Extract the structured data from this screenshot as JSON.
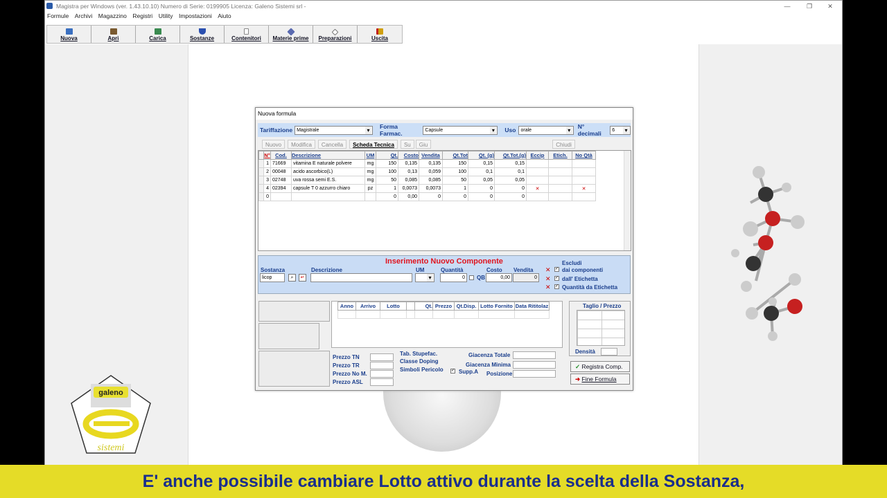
{
  "window": {
    "title": "Magistra per Windows  (ver. 1.43.10.10)  Numero di Serie: 0199905   Licenza: Galeno Sistemi srl  -",
    "min": "—",
    "max": "❐",
    "close": "✕"
  },
  "menu": [
    "Formule",
    "Archivi",
    "Magazzino",
    "Registri",
    "Utility",
    "Impostazioni",
    "Aiuto"
  ],
  "toolbar": [
    {
      "label": "Nuova",
      "icon": "new-icon",
      "color": "#3a6fc0"
    },
    {
      "label": "Apri",
      "icon": "open-icon",
      "color": "#7a5a30"
    },
    {
      "label": "Carica",
      "icon": "load-icon",
      "color": "#3a8a50"
    },
    {
      "label": "Sostanze",
      "icon": "flask-icon",
      "color": "#2a4fb0"
    },
    {
      "label": "Contenitori",
      "icon": "bottle-icon",
      "color": "#888888"
    },
    {
      "label": "Materie prime",
      "icon": "diamond-icon",
      "color": "#5a6ab0"
    },
    {
      "label": "Preparazioni",
      "icon": "eraser-icon",
      "color": "#999999"
    },
    {
      "label": "Uscita",
      "icon": "exit-door-icon",
      "color": "#d0a010"
    }
  ],
  "dialog": {
    "title": "Nuova formula",
    "tariffazione_label": "Tariffazione",
    "tariffazione_value": "Magistrale",
    "forma_label": "Forma Farmac.",
    "forma_value": "Capsule",
    "uso_label": "Uso",
    "uso_value": "orale",
    "decimali_label": "N° decimali",
    "decimali_value": "6",
    "actions": [
      "Nuovo",
      "Modifica",
      "Cancella",
      "Scheda Tecnica",
      "Su",
      "Giu",
      "Chiudi"
    ],
    "grid": {
      "headers": [
        "N°",
        "Cod.",
        "Descrizione",
        "UM",
        "Qt.",
        "Costo",
        "Vendita",
        "Qt.Tot",
        "Qt. (g)",
        "Qt.Tot.(g)",
        "Eccip",
        "Etich.",
        "No Qtà"
      ],
      "rows": [
        [
          "1",
          "71669",
          "vitamina E naturale polvere",
          "mg",
          "150",
          "0,135",
          "0,135",
          "150",
          "0,15",
          "0,15",
          "",
          "",
          ""
        ],
        [
          "2",
          "00048",
          "acido ascorbico(L)",
          "mg",
          "100",
          "0,13",
          "0,059",
          "100",
          "0,1",
          "0,1",
          "",
          "",
          ""
        ],
        [
          "3",
          "02748",
          "uva rossa semi E.S.",
          "mg",
          "50",
          "0,085",
          "0,085",
          "50",
          "0,05",
          "0,05",
          "",
          "",
          ""
        ],
        [
          "4",
          "02394",
          "capsule T 0 azzurro chiaro",
          "pz",
          "1",
          "0,0073",
          "0,0073",
          "1",
          "0",
          "0",
          "✕",
          "",
          "✕"
        ],
        [
          "0",
          "",
          "",
          "",
          "0",
          "0,00",
          "0",
          "0",
          "0",
          "0",
          "",
          "",
          ""
        ]
      ]
    },
    "insert": {
      "title": "Inserimento Nuovo Componente",
      "sostanza_label": "Sostanza",
      "sostanza_value": "licop",
      "descrizione_label": "Descrizione",
      "um_label": "UM",
      "quantita_label": "Quantità",
      "quantita_value": "0",
      "qb_label": "QB",
      "costo_label": "Costo",
      "costo_value": "0,00",
      "vendita_label": "Vendita",
      "vendita_value": "0",
      "escludi_label": "Escludi",
      "opt1": "dai componenti",
      "opt2": "dall' Etichetta",
      "opt3": "Quantità da Etichetta"
    },
    "lots": {
      "headers": [
        "Anno",
        "Arrivo",
        "Lotto",
        "",
        "Qt.",
        "Prezzo",
        "Qt.Disp.",
        "Lotto Fornito",
        "Data Rititolaz"
      ]
    },
    "prices": {
      "prezzo_tn": "Prezzo TN",
      "prezzo_tr": "Prezzo TR",
      "prezzo_nom": "Prezzo No M.",
      "prezzo_asl": "Prezzo ASL",
      "stupefac": "Tab. Stupefac.",
      "doping": "Classe Doping",
      "pericolo": "Simboli Pericolo",
      "supp": "Supp.A",
      "giacenza_totale": "Giacenza Totale",
      "giacenza_minima": "Giacenza Minima",
      "posizione": "Posizione"
    },
    "taglio_label": "Taglio / Prezzo",
    "densita_label": "Densità",
    "registra_label": "Registra Comp.",
    "fine_label": "Fine Formula"
  },
  "logo": {
    "text": "galeno",
    "script": "sistemi"
  },
  "caption": "E' anche possibile cambiare Lotto attivo durante la scelta della Sostanza,"
}
